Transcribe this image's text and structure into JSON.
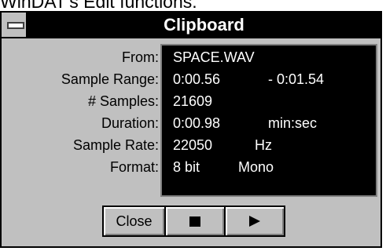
{
  "page_text": "WinDAT's Edit functions.",
  "window": {
    "title": "Clipboard",
    "system_menu_icon": "system-menu-icon"
  },
  "info": {
    "rows": [
      {
        "label": "From:",
        "value": "SPACE.WAV",
        "extra": ""
      },
      {
        "label": "Sample Range:",
        "value": "0:00.56",
        "extra": "- 0:01.54"
      },
      {
        "label": "# Samples:",
        "value": "21609",
        "extra": ""
      },
      {
        "label": "Duration:",
        "value": "0:00.98",
        "extra": "min:sec"
      },
      {
        "label": "Sample Rate:",
        "value": "22050",
        "extra": "Hz"
      },
      {
        "label": "Format:",
        "value": "8 bit",
        "extra": "Mono"
      }
    ]
  },
  "buttons": {
    "close_label": "Close",
    "stop_icon": "stop-icon",
    "play_icon": "play-icon"
  },
  "colors": {
    "window_bg": "#c0c0c0",
    "titlebar_bg": "#000000",
    "title_text": "#ffffff",
    "panel_bg": "#000000",
    "panel_text": "#ffffff"
  }
}
